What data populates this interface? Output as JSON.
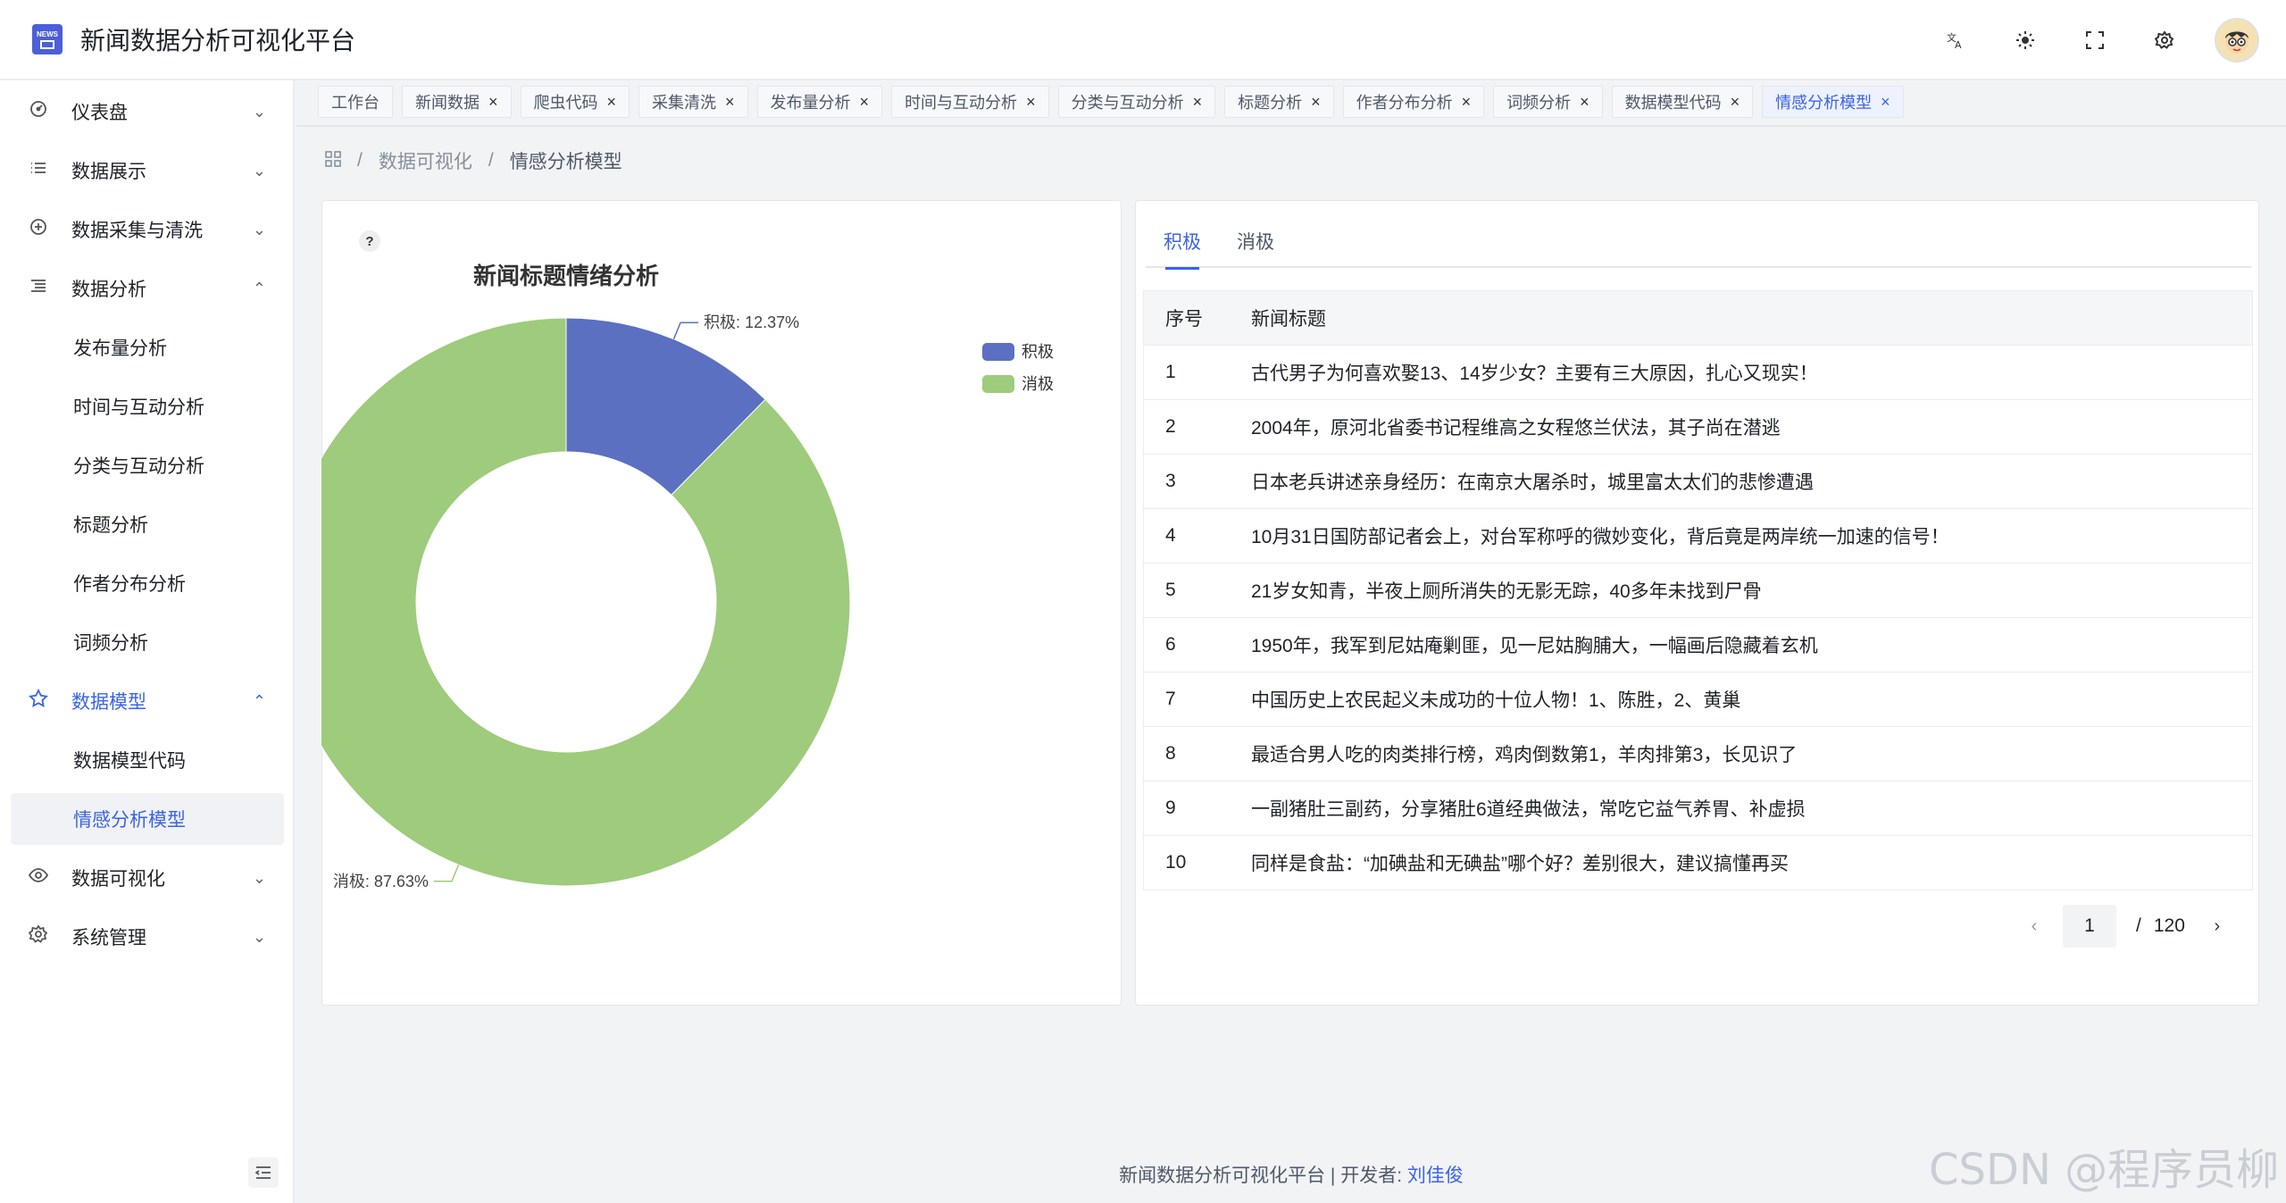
{
  "app": {
    "title": "新闻数据分析可视化平台",
    "logo_text": "NEWS"
  },
  "sidebar": {
    "items": [
      {
        "label": "仪表盘",
        "icon": "dashboard-icon"
      },
      {
        "label": "数据展示",
        "icon": "list-icon"
      },
      {
        "label": "数据采集与清洗",
        "icon": "plus-circle-icon"
      },
      {
        "label": "数据分析",
        "icon": "align-icon"
      },
      {
        "label": "发布量分析"
      },
      {
        "label": "时间与互动分析"
      },
      {
        "label": "分类与互动分析"
      },
      {
        "label": "标题分析"
      },
      {
        "label": "作者分布分析"
      },
      {
        "label": "词频分析"
      },
      {
        "label": "数据模型",
        "icon": "star-icon"
      },
      {
        "label": "数据模型代码"
      },
      {
        "label": "情感分析模型"
      },
      {
        "label": "数据可视化",
        "icon": "eye-icon"
      },
      {
        "label": "系统管理",
        "icon": "gear-icon"
      }
    ]
  },
  "tabs": [
    "工作台",
    "新闻数据",
    "爬虫代码",
    "采集清洗",
    "发布量分析",
    "时间与互动分析",
    "分类与互动分析",
    "标题分析",
    "作者分布分析",
    "词频分析",
    "数据模型代码",
    "情感分析模型"
  ],
  "breadcrumb": [
    "数据可视化",
    "情感分析模型"
  ],
  "chart_data": {
    "type": "pie",
    "donut": true,
    "title": "新闻标题情绪分析",
    "legend_position": "top-right",
    "slices": [
      {
        "name": "积极",
        "value": 12.37,
        "label": "积极: 12.37%",
        "color": "#5b70c1"
      },
      {
        "name": "消极",
        "value": 87.63,
        "label": "消极: 87.63%",
        "color": "#9ecb7c"
      }
    ]
  },
  "right_panel": {
    "tabs": [
      "积极",
      "消极"
    ],
    "columns": [
      "序号",
      "新闻标题"
    ],
    "rows": [
      [
        "1",
        "古代男子为何喜欢娶13、14岁少女？主要有三大原因，扎心又现实！"
      ],
      [
        "2",
        "2004年，原河北省委书记程维高之女程悠兰伏法，其子尚在潜逃"
      ],
      [
        "3",
        "日本老兵讲述亲身经历：在南京大屠杀时，城里富太太们的悲惨遭遇"
      ],
      [
        "4",
        "10月31日国防部记者会上，对台军称呼的微妙变化，背后竟是两岸统一加速的信号！"
      ],
      [
        "5",
        "21岁女知青，半夜上厕所消失的无影无踪，40多年未找到尸骨"
      ],
      [
        "6",
        "1950年，我军到尼姑庵剿匪，见一尼姑胸脯大，一幅画后隐藏着玄机"
      ],
      [
        "7",
        "中国历史上农民起义未成功的十位人物！1、陈胜，2、黄巢"
      ],
      [
        "8",
        "最适合男人吃的肉类排行榜，鸡肉倒数第1，羊肉排第3，长见识了"
      ],
      [
        "9",
        "一副猪肚三副药，分享猪肚6道经典做法，常吃它益气养胃、补虚损"
      ],
      [
        "10",
        "同样是食盐：“加碘盐和无碘盐”哪个好？差别很大，建议搞懂再买"
      ]
    ],
    "pager": {
      "current": "1",
      "separator": "/",
      "total": "120"
    }
  },
  "footer": {
    "text": "新闻数据分析可视化平台 | 开发者:",
    "developer": "刘佳俊"
  },
  "watermark": "CSDN @程序员柳"
}
